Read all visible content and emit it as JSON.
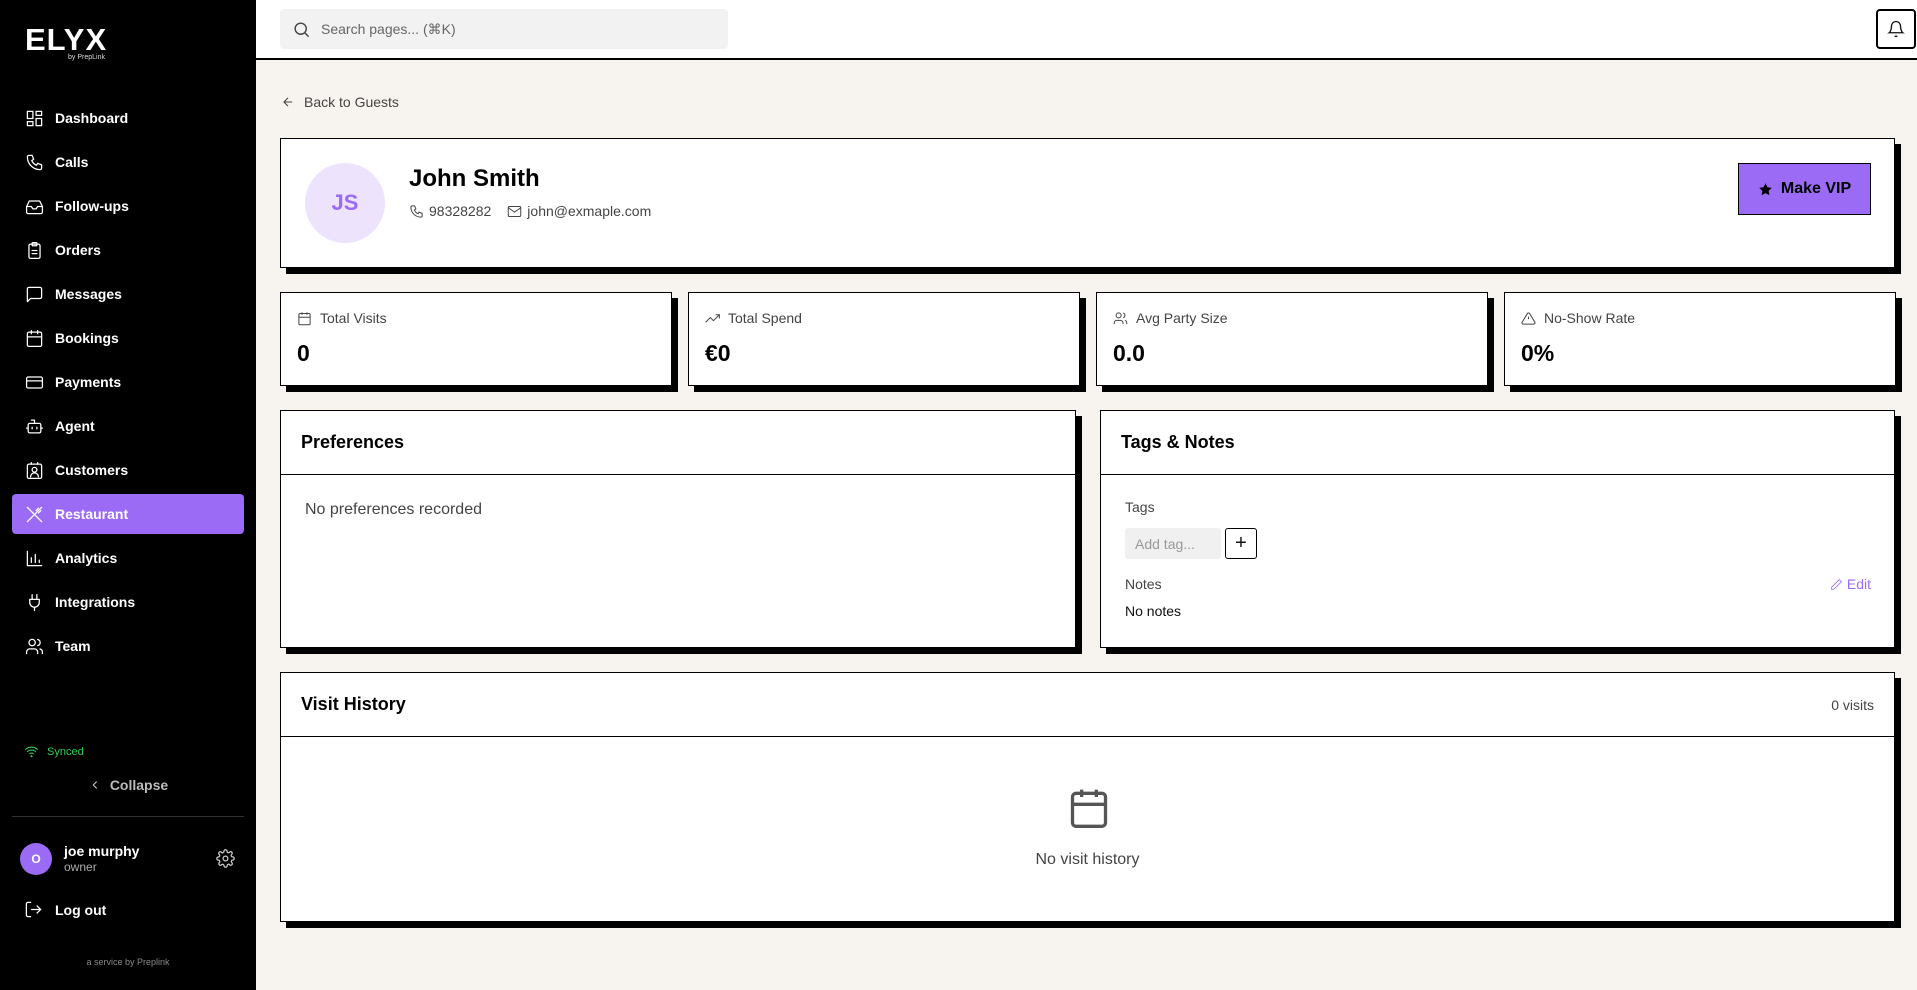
{
  "brand": {
    "logo": "ELYX",
    "logo_sub": "by PrepLink",
    "service": "a service by Preplink",
    "accent": "#9b6bf5"
  },
  "sidebar": {
    "items": [
      {
        "label": "Dashboard",
        "icon": "dashboard-icon"
      },
      {
        "label": "Calls",
        "icon": "phone-icon"
      },
      {
        "label": "Follow-ups",
        "icon": "inbox-icon"
      },
      {
        "label": "Orders",
        "icon": "clipboard-icon"
      },
      {
        "label": "Messages",
        "icon": "message-icon"
      },
      {
        "label": "Bookings",
        "icon": "calendar-icon"
      },
      {
        "label": "Payments",
        "icon": "credit-card-icon"
      },
      {
        "label": "Agent",
        "icon": "bot-icon"
      },
      {
        "label": "Customers",
        "icon": "contact-icon"
      },
      {
        "label": "Restaurant",
        "icon": "utensils-icon",
        "active": true
      },
      {
        "label": "Analytics",
        "icon": "bar-chart-icon"
      },
      {
        "label": "Integrations",
        "icon": "plug-icon"
      },
      {
        "label": "Team",
        "icon": "users-icon"
      }
    ],
    "sync_status": "Synced",
    "collapse_label": "Collapse",
    "user": {
      "initial": "O",
      "name": "joe murphy",
      "role": "owner"
    },
    "logout_label": "Log out"
  },
  "topbar": {
    "search_placeholder": "Search pages... (⌘K)"
  },
  "back_link": "Back to Guests",
  "guest": {
    "initials": "JS",
    "name": "John Smith",
    "phone": "98328282",
    "email": "john@exmaple.com",
    "vip_button": "Make VIP"
  },
  "stats": [
    {
      "label": "Total Visits",
      "value": "0",
      "icon": "calendar-icon"
    },
    {
      "label": "Total Spend",
      "value": "€0",
      "icon": "trending-up-icon"
    },
    {
      "label": "Avg Party Size",
      "value": "0.0",
      "icon": "users-icon"
    },
    {
      "label": "No-Show Rate",
      "value": "0%",
      "icon": "alert-triangle-icon"
    }
  ],
  "preferences": {
    "title": "Preferences",
    "empty": "No preferences recorded"
  },
  "tags_notes": {
    "title": "Tags & Notes",
    "tags_label": "Tags",
    "tag_placeholder": "Add tag...",
    "add_symbol": "+",
    "notes_label": "Notes",
    "edit_label": "Edit",
    "notes_value": "No notes"
  },
  "visit_history": {
    "title": "Visit History",
    "count": "0 visits",
    "empty": "No visit history"
  }
}
